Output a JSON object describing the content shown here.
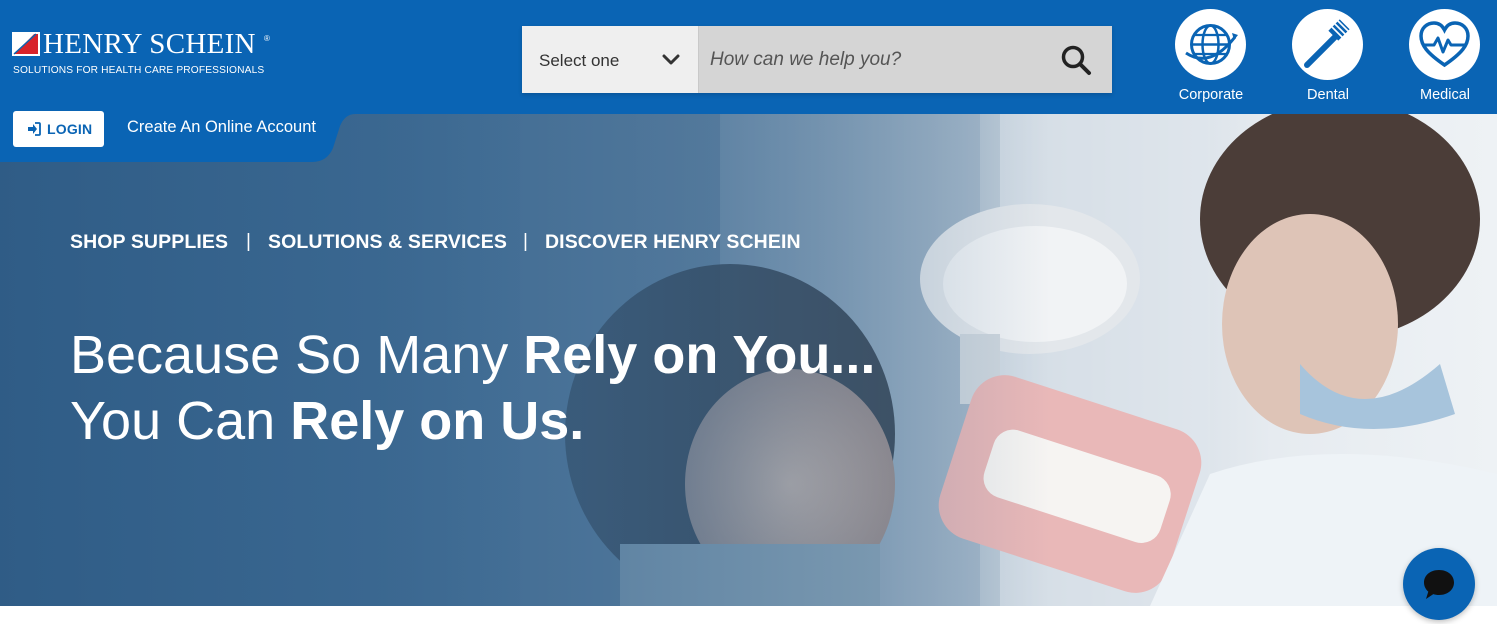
{
  "brand": {
    "name": "HENRY SCHEIN",
    "registered_mark": "®",
    "tagline": "SOLUTIONS FOR HEALTH CARE PROFESSIONALS"
  },
  "search": {
    "select_label": "Select one",
    "placeholder": "How can we help you?"
  },
  "divisions": [
    {
      "label": "Corporate",
      "icon": "globe-icon"
    },
    {
      "label": "Dental",
      "icon": "toothbrush-icon"
    },
    {
      "label": "Medical",
      "icon": "heart-pulse-icon"
    }
  ],
  "account": {
    "login_label": "LOGIN",
    "create_label": "Create An Online Account"
  },
  "nav": {
    "items": [
      "SHOP SUPPLIES",
      "SOLUTIONS & SERVICES",
      "DISCOVER HENRY SCHEIN"
    ],
    "separator": "|"
  },
  "hero": {
    "line1_light": "Because So Many ",
    "line1_bold": "Rely on You...",
    "line2_light": "You Can ",
    "line2_bold": "Rely on Us."
  },
  "colors": {
    "brand_blue": "#0a64b4",
    "logo_red": "#d8232a"
  }
}
